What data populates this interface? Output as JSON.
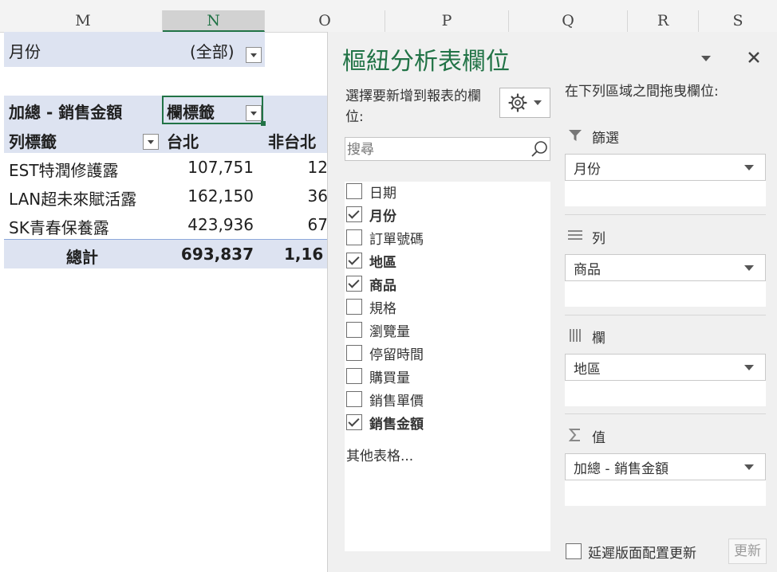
{
  "columns": [
    "M",
    "N",
    "O",
    "P",
    "Q",
    "R",
    "S"
  ],
  "sheet": {
    "filter_label": "月份",
    "filter_value": "(全部)",
    "sum_header": "加總 - 銷售金額",
    "col_label_header": "欄標籤",
    "row_label_header": "列標籤",
    "col_region_1": "台北",
    "col_region_2": "非台北",
    "rows": [
      {
        "label": "EST特潤修護露",
        "v1": "107,751",
        "v2": "12"
      },
      {
        "label": "LAN超未來賦活露",
        "v1": "162,150",
        "v2": "36"
      },
      {
        "label": "SK青春保養露",
        "v1": "423,936",
        "v2": "67"
      }
    ],
    "total_label": "總計",
    "total_v1": "693,837",
    "total_v2": "1,16"
  },
  "pane": {
    "title": "樞紐分析表欄位",
    "choose_text_1": "選擇要新增到報表的欄",
    "choose_text_2": "位:",
    "drag_text": "在下列區域之間拖曳欄位:",
    "search_placeholder": "搜尋",
    "fields": [
      {
        "label": "日期",
        "checked": false,
        "bold": false
      },
      {
        "label": "月份",
        "checked": true,
        "bold": true
      },
      {
        "label": "訂單號碼",
        "checked": false,
        "bold": false
      },
      {
        "label": "地區",
        "checked": true,
        "bold": true
      },
      {
        "label": "商品",
        "checked": true,
        "bold": true
      },
      {
        "label": "規格",
        "checked": false,
        "bold": false
      },
      {
        "label": "瀏覽量",
        "checked": false,
        "bold": false
      },
      {
        "label": "停留時間",
        "checked": false,
        "bold": false
      },
      {
        "label": "購買量",
        "checked": false,
        "bold": false
      },
      {
        "label": "銷售單價",
        "checked": false,
        "bold": false
      },
      {
        "label": "銷售金額",
        "checked": true,
        "bold": true
      }
    ],
    "more_tables": "其他表格...",
    "areas": {
      "filters": {
        "title": "篩選",
        "item": "月份"
      },
      "rows": {
        "title": "列",
        "item": "商品"
      },
      "columns": {
        "title": "欄",
        "item": "地區"
      },
      "values": {
        "title": "值",
        "item": "加總 - 銷售金額"
      }
    },
    "defer_label": "延遲版面配置更新",
    "update_label": "更新"
  }
}
